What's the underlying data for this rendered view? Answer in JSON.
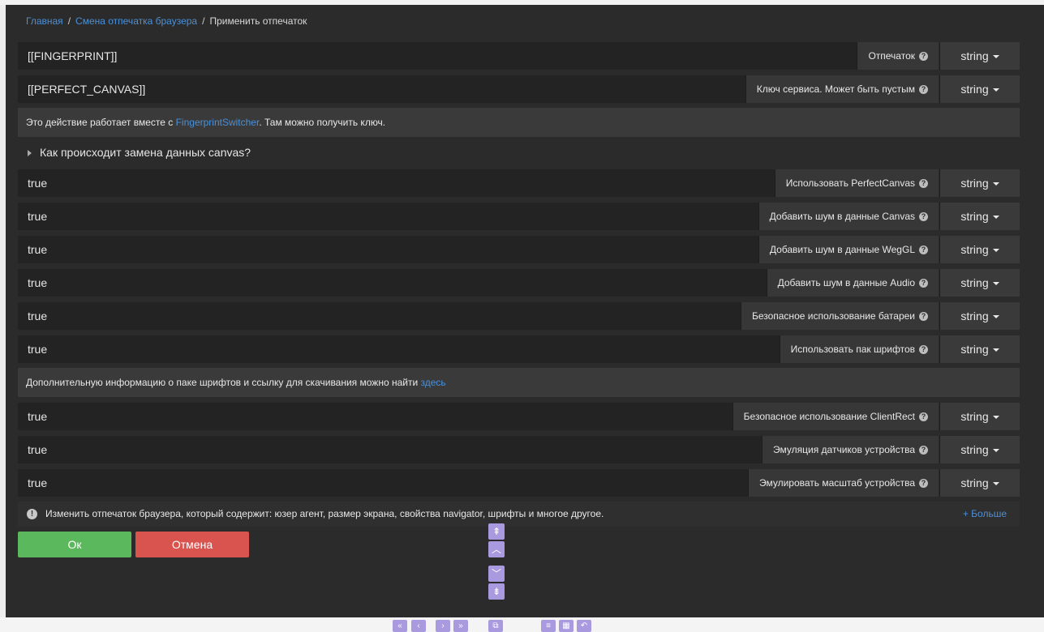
{
  "breadcrumb": {
    "home": "Главная",
    "parent": "Смена отпечатка браузера",
    "current": "Применить отпечаток",
    "separator": "/"
  },
  "fields": [
    {
      "value": "[[FINGERPRINT]]",
      "label": "Отпечаток",
      "type": "string"
    },
    {
      "value": "[[PERFECT_CANVAS]]",
      "label": "Ключ сервиса. Может быть пустым",
      "type": "string"
    },
    {
      "value": "true",
      "label": "Использовать PerfectCanvas",
      "type": "string"
    },
    {
      "value": "true",
      "label": "Добавить шум в данные Canvas",
      "type": "string"
    },
    {
      "value": "true",
      "label": "Добавить шум в данные WegGL",
      "type": "string"
    },
    {
      "value": "true",
      "label": "Добавить шум в данные Audio",
      "type": "string"
    },
    {
      "value": "true",
      "label": "Безопасное использование батареи",
      "type": "string"
    },
    {
      "value": "true",
      "label": "Использовать пак шрифтов",
      "type": "string"
    },
    {
      "value": "true",
      "label": "Безопасное использование ClientRect",
      "type": "string"
    },
    {
      "value": "true",
      "label": "Эмуляция датчиков устройства",
      "type": "string"
    },
    {
      "value": "true",
      "label": "Эмулировать масштаб устройства",
      "type": "string"
    }
  ],
  "info1": {
    "prefix": "Это действие работает вместе с ",
    "link": "FingerprintSwitcher",
    "suffix": ". Там можно получить ключ."
  },
  "toggle": {
    "label": "Как происходит замена данных canvas?"
  },
  "info2": {
    "prefix": "Дополнительную информацию о паке шрифтов и ссылку для скачивания можно найти ",
    "link": "здесь"
  },
  "description": {
    "text": "Изменить отпечаток браузера, который содержит: юзер агент, размер экрана, свойства navigator, шрифты и многое другое.",
    "more": "+ Больше"
  },
  "buttons": {
    "ok": "Ок",
    "cancel": "Отмена"
  },
  "icons": {
    "help": "question-circle-icon",
    "exclamation": "exclamation-circle-icon",
    "caret": "caret-down-icon",
    "toggle": "triangle-right-icon"
  },
  "colors": {
    "link": "#4a90d9",
    "ok": "#5cb85c",
    "cancel": "#d9534f",
    "nav": "#a99ae0"
  }
}
